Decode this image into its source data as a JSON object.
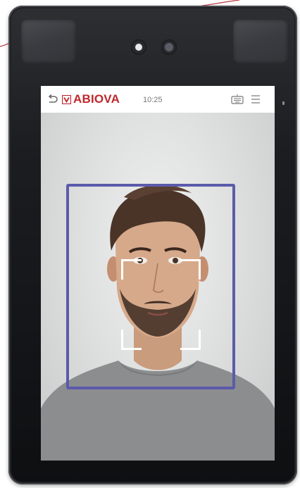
{
  "header": {
    "brand": "ABIOVA",
    "time": "10:25"
  },
  "icons": {
    "back": "back-arrow-icon",
    "logo_mark": "logo-mark-icon",
    "keyboard": "keyboard-icon",
    "menu": "hamburger-menu-icon"
  },
  "colors": {
    "brand": "#c0272d",
    "face_box": "#5b5bab",
    "bracket": "#ffffff",
    "device_body": "#1c1d20"
  }
}
